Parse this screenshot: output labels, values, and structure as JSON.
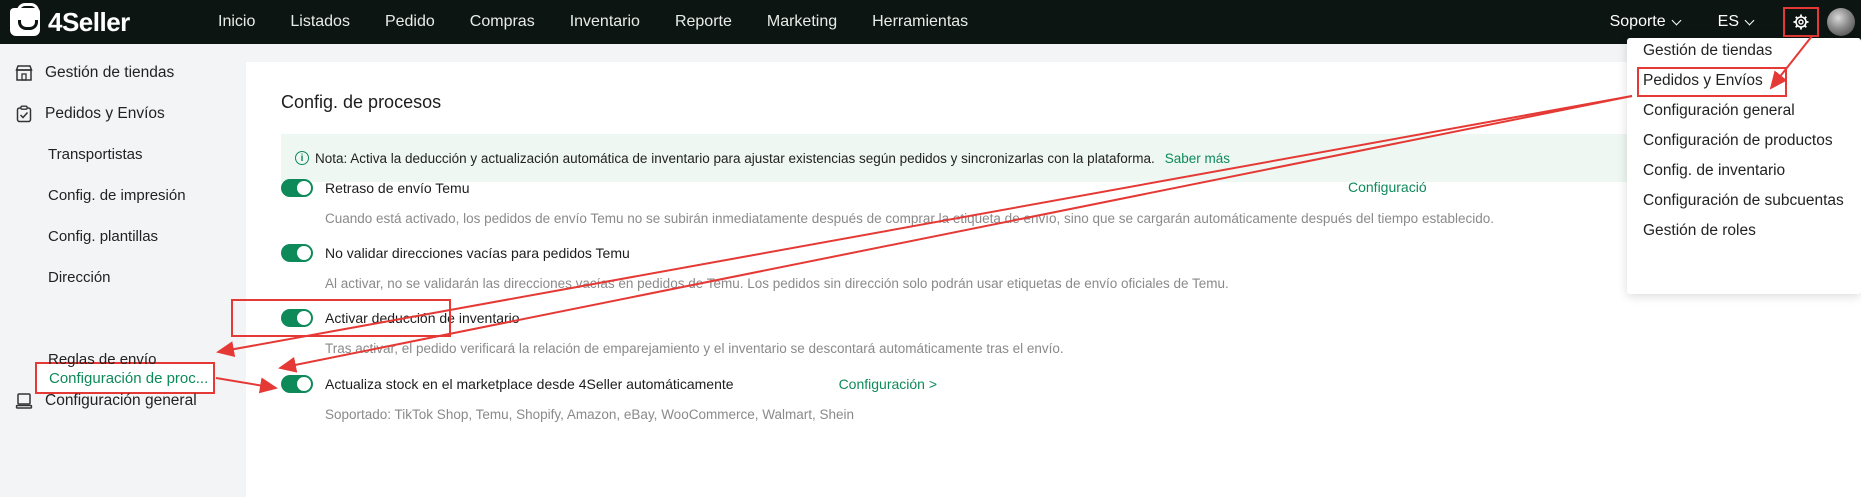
{
  "brand": {
    "name": "4Seller"
  },
  "topnav": {
    "items": [
      "Inicio",
      "Listados",
      "Pedido",
      "Compras",
      "Inventario",
      "Reporte",
      "Marketing",
      "Herramientas"
    ],
    "support": "Soporte",
    "language": "ES"
  },
  "sidebar": {
    "groups": [
      {
        "label": "Gestión de tiendas",
        "icon": "store-icon"
      },
      {
        "label": "Pedidos y Envíos",
        "icon": "clipboard-check-icon"
      },
      {
        "label": "Configuración general",
        "icon": "monitor-icon"
      }
    ],
    "sub_items": [
      "Transportistas",
      "Config. de impresión",
      "Config. plantillas",
      "Dirección",
      "Configuración de proc...",
      "Reglas de envío"
    ],
    "active_index": 4
  },
  "page": {
    "title": "Config. de procesos",
    "notice": {
      "text": "Nota: Activa la deducción y actualización automática de inventario para ajustar existencias según pedidos y sincronizarlas con la plataforma.",
      "link": "Saber más"
    },
    "settings": [
      {
        "label": "Retraso de envío Temu",
        "enabled": true,
        "description": "Cuando está activado, los pedidos de envío Temu no se subirán inmediatamente después de comprar la etiqueta de envío, sino que se cargarán automáticamente después del tiempo establecido.",
        "config_link": "Configuració"
      },
      {
        "label": "No validar direcciones vacías para pedidos Temu",
        "enabled": true,
        "description": "Al activar, no se validarán las direcciones vacías en pedidos de Temu. Los pedidos sin dirección solo podrán usar etiquetas de envío oficiales de Temu."
      },
      {
        "label": "Activar deducción de inventario",
        "enabled": true,
        "description": "Tras activar, el pedido verificará la relación de emparejamiento y el inventario se descontará automáticamente tras el envío."
      },
      {
        "label": "Actualiza stock en el marketplace desde 4Seller automáticamente",
        "enabled": true,
        "description": "Soportado: TikTok Shop, Temu, Shopify, Amazon, eBay, WooCommerce, Walmart, Shein",
        "config_link": "Configuración >"
      }
    ]
  },
  "settings_menu": {
    "items": [
      "Gestión de tiendas",
      "Pedidos y Envíos",
      "Configuración general",
      "Configuración de productos",
      "Config. de inventario",
      "Configuración de subcuentas",
      "Gestión de roles"
    ],
    "highlighted_index": 1
  },
  "colors": {
    "accent": "#0e8a5a",
    "annotation": "#e53935",
    "topbar": "#0d1512"
  }
}
